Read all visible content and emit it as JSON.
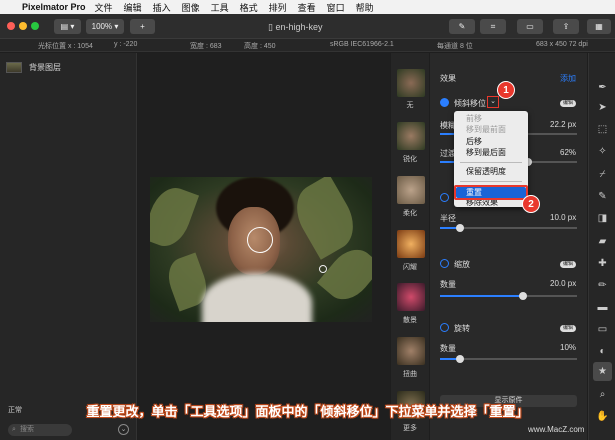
{
  "menubar": {
    "app_name": "Pixelmator Pro",
    "items": [
      "文件",
      "编辑",
      "插入",
      "图像",
      "工具",
      "格式",
      "排列",
      "查看",
      "窗口",
      "帮助"
    ]
  },
  "toolbar": {
    "zoom": "100%",
    "add": "+",
    "document_title": "en-high-key"
  },
  "infobar": {
    "cursor_label": "光标位置 x : 1054",
    "cursor_y": "y : -220",
    "width": "宽度 : 683",
    "height": "高度 : 450",
    "color_profile": "sRGB IEC61966-2.1",
    "channel": "每通道 8 位",
    "dimensions": "683 x 450 72 dpi"
  },
  "layers": {
    "background_layer": "背景图层",
    "blend_mode": "正常",
    "opacity": "100",
    "search_placeholder": "搜索"
  },
  "presets": [
    "无",
    "锐化",
    "柔化",
    "闪耀",
    "散景",
    "扭曲",
    "更多"
  ],
  "panel": {
    "section_title": "效果",
    "add_link": "添加",
    "effects": [
      {
        "name": "倾斜移位",
        "badge": "编辑"
      },
      {
        "name": "缩放",
        "badge": "编辑"
      },
      {
        "name": "旋转",
        "badge": "编辑"
      }
    ],
    "labels": {
      "blur": "模糊",
      "blur_value": "22.2 px",
      "transition": "过渡",
      "transition_value": "62%",
      "radius": "半径",
      "radius_value": "10.0 px",
      "amount": "数量",
      "amount_value": "20.0 px",
      "amount2": "数量",
      "amount2_value": "10%",
      "show_original": "显示原件",
      "reset": "重置"
    }
  },
  "dropdown": {
    "items": [
      "前移",
      "移到最前面",
      "后移",
      "移到最后面",
      "保留透明度",
      "重置",
      "移除效果"
    ]
  },
  "markers": [
    "1",
    "2"
  ],
  "caption": "重置更改，单击「工具选项」面板中的「倾斜移位」下拉菜单并选择「重置」",
  "watermark": "www.MacZ.com",
  "colors": {
    "accent": "#2b7fff",
    "marker": "#e8382d",
    "selection": "#1a64d6"
  }
}
